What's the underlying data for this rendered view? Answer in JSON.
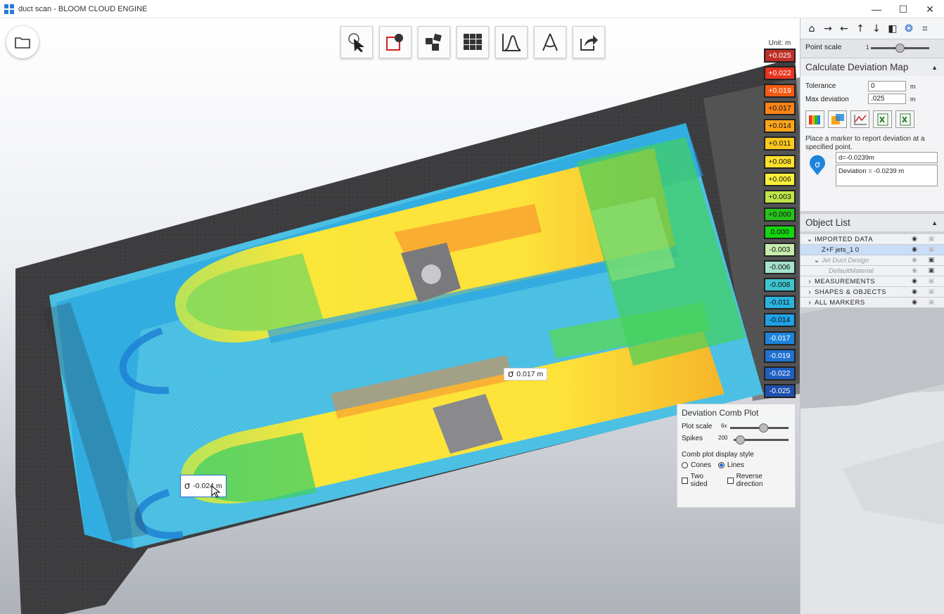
{
  "window": {
    "title": "duct scan - BLOOM CLOUD ENGINE",
    "minimize": "—",
    "maximize": "☐",
    "close": "✕"
  },
  "toolbar": {
    "tools": [
      {
        "name": "select-tool",
        "icon": "cursor-icon"
      },
      {
        "name": "clip-tool",
        "icon": "clip-box-icon"
      },
      {
        "name": "segment-tool",
        "icon": "segment-icon"
      },
      {
        "name": "grid-tool",
        "icon": "grid-icon"
      },
      {
        "name": "profile-tool",
        "icon": "profile-curve-icon"
      },
      {
        "name": "measure-tool",
        "icon": "compass-icon"
      },
      {
        "name": "export-tool",
        "icon": "share-icon"
      }
    ]
  },
  "legend": {
    "unit": "Unit: m",
    "items": [
      {
        "label": "+0.025",
        "color": "#c0302a",
        "text": "#ffffff"
      },
      {
        "label": "+0.022",
        "color": "#e8341f",
        "text": "#ffffff"
      },
      {
        "label": "+0.019",
        "color": "#f65a12",
        "text": "#ffffff"
      },
      {
        "label": "+0.017",
        "color": "#f98316",
        "text": "#111111"
      },
      {
        "label": "+0.014",
        "color": "#fca51a",
        "text": "#111111"
      },
      {
        "label": "+0.011",
        "color": "#fec81f",
        "text": "#111111"
      },
      {
        "label": "+0.008",
        "color": "#fde12b",
        "text": "#111111"
      },
      {
        "label": "+0.006",
        "color": "#fbef3a",
        "text": "#111111"
      },
      {
        "label": "+0.003",
        "color": "#bfe34a",
        "text": "#111111"
      },
      {
        "label": "+0.000",
        "color": "#27c21b",
        "text": "#111111"
      },
      {
        "label": "0.000",
        "color": "#13d60f",
        "text": "#111111"
      },
      {
        "label": "-0.003",
        "color": "#c6ecae",
        "text": "#111111"
      },
      {
        "label": "-0.006",
        "color": "#a4e2cf",
        "text": "#111111"
      },
      {
        "label": "-0.008",
        "color": "#3dc4cf",
        "text": "#111111"
      },
      {
        "label": "-0.011",
        "color": "#2bb3de",
        "text": "#111111"
      },
      {
        "label": "-0.014",
        "color": "#1ea1e6",
        "text": "#111111"
      },
      {
        "label": "-0.017",
        "color": "#1e84db",
        "text": "#ffffff"
      },
      {
        "label": "-0.019",
        "color": "#1f72cf",
        "text": "#ffffff"
      },
      {
        "label": "-0.022",
        "color": "#1f60c1",
        "text": "#ffffff"
      },
      {
        "label": "-0.025",
        "color": "#1e4fae",
        "text": "#ffffff"
      }
    ]
  },
  "markers": [
    {
      "symbol": "σ",
      "text": "0.017 m"
    },
    {
      "symbol": "σ",
      "text": "-0.024 m"
    }
  ],
  "comb_plot": {
    "title": "Deviation Comb Plot",
    "plot_scale_label": "Plot scale",
    "plot_scale_value": "6x",
    "plot_scale_fraction": 0.58,
    "spikes_label": "Spikes",
    "spikes_value": "200",
    "spikes_fraction": 0.05,
    "style_label": "Comb plot display style",
    "cones_label": "Cones",
    "lines_label": "Lines",
    "selected_style": "Lines",
    "two_sided_label": "Two sided",
    "reverse_label": "Reverse direction"
  },
  "panel": {
    "point_scale_label": "Point scale",
    "point_scale_value": "1",
    "point_scale_fraction": 0.5,
    "deviation": {
      "header": "Calculate Deviation Map",
      "tolerance_label": "Tolerance",
      "tolerance_value": "0",
      "tolerance_unit": "m",
      "max_dev_label": "Max deviation",
      "max_dev_value": ".025",
      "max_dev_unit": "m",
      "buttons": [
        "color-map-icon",
        "compare-icon",
        "chart-axes-icon",
        "excel-export-icon",
        "excel-report-icon"
      ],
      "hint": "Place a marker to report deviation at a specified point.",
      "marker_value": "d=-0.0239m",
      "marker_detail": "Deviation = -0.0239 m"
    },
    "object_list": {
      "header": "Object List",
      "rows": [
        {
          "label": "IMPORTED DATA",
          "arrow": "⌄",
          "indent": 0,
          "caps": true
        },
        {
          "label": "Z+F jets_1 0",
          "arrow": "",
          "indent": 1,
          "selected": true
        },
        {
          "label": "Jet Duct Design",
          "arrow": "⌄",
          "indent": 1,
          "dim": true
        },
        {
          "label": "DefaultMaterial",
          "arrow": "",
          "indent": 2,
          "dim": true
        },
        {
          "label": "MEASUREMENTS",
          "arrow": "›",
          "indent": 0,
          "caps": true
        },
        {
          "label": "SHAPES & OBJECTS",
          "arrow": "›",
          "indent": 0,
          "caps": true
        },
        {
          "label": "ALL MARKERS",
          "arrow": "›",
          "indent": 0,
          "caps": true
        }
      ]
    }
  }
}
